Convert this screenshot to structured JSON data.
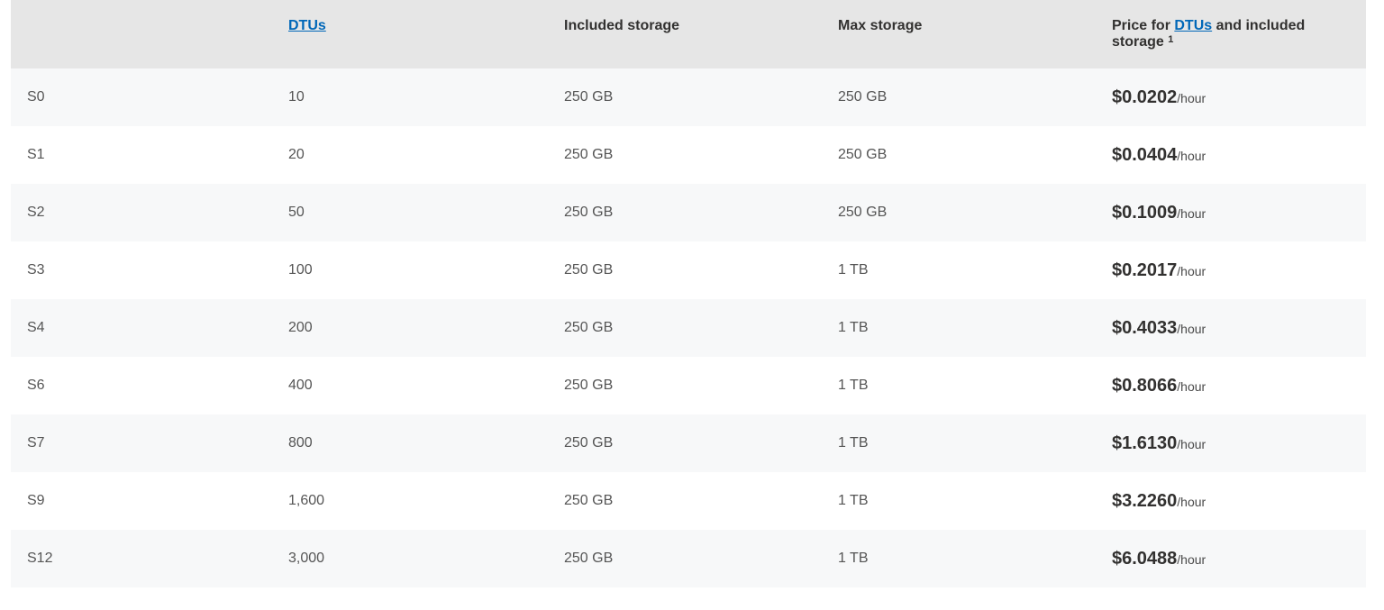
{
  "table": {
    "headers": {
      "tier": "",
      "dtus_link": "DTUs",
      "included_storage": "Included storage",
      "max_storage": "Max storage",
      "price_prefix": "Price for ",
      "price_link": "DTUs",
      "price_suffix": " and included storage ",
      "price_footnote": "1"
    },
    "price_unit": "/hour",
    "rows": [
      {
        "tier": "S0",
        "dtus": "10",
        "included": "250 GB",
        "max": "250 GB",
        "price": "$0.0202"
      },
      {
        "tier": "S1",
        "dtus": "20",
        "included": "250 GB",
        "max": "250 GB",
        "price": "$0.0404"
      },
      {
        "tier": "S2",
        "dtus": "50",
        "included": "250 GB",
        "max": "250 GB",
        "price": "$0.1009"
      },
      {
        "tier": "S3",
        "dtus": "100",
        "included": "250 GB",
        "max": "1 TB",
        "price": "$0.2017"
      },
      {
        "tier": "S4",
        "dtus": "200",
        "included": "250 GB",
        "max": "1 TB",
        "price": "$0.4033"
      },
      {
        "tier": "S6",
        "dtus": "400",
        "included": "250 GB",
        "max": "1 TB",
        "price": "$0.8066"
      },
      {
        "tier": "S7",
        "dtus": "800",
        "included": "250 GB",
        "max": "1 TB",
        "price": "$1.6130"
      },
      {
        "tier": "S9",
        "dtus": "1,600",
        "included": "250 GB",
        "max": "1 TB",
        "price": "$3.2260"
      },
      {
        "tier": "S12",
        "dtus": "3,000",
        "included": "250 GB",
        "max": "1 TB",
        "price": "$6.0488"
      }
    ]
  }
}
